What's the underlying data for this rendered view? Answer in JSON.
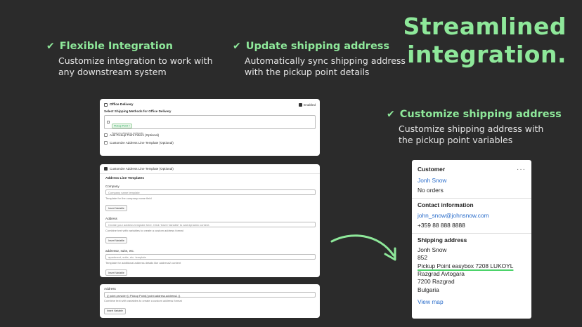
{
  "headline": {
    "line1": "Streamlined",
    "line2": "integration."
  },
  "features": [
    {
      "title": "Flexible Integration",
      "desc_l1": "Customize integration to work with",
      "desc_l2": "any downstream system"
    },
    {
      "title": "Update shipping address",
      "desc_l1": "Automatically sync shipping address",
      "desc_l2": "with the pickup point details"
    },
    {
      "title": "Customize shipping address",
      "desc_l1": "Customize  shipping address with",
      "desc_l2": "the pickup point variables"
    }
  ],
  "check_glyph": "✔",
  "office_card": {
    "title": "Office Delivery",
    "enabled_label": "Enabled",
    "select_label": "Select Shipping Methods for Office Delivery",
    "tag": "Pickup Point",
    "search_placeholder": "Search shipping methods",
    "opt1": "Add Pickup Point Filters (Optional)",
    "opt2": "Customize Address Line Template (Optional)"
  },
  "template_card": {
    "header": "Customize Address Line Template (Optional)",
    "section_title": "Address Line Templates",
    "fields": [
      {
        "label": "Company",
        "placeholder": "Company name template",
        "help": "Template for the company name field",
        "button": "Insert Variable"
      },
      {
        "label": "Address",
        "placeholder": "Create your address template here. Click 'Insert Variable' to add dynamic content.",
        "help": "Combine text with variables to create a custom address format",
        "button": "Insert Variable"
      },
      {
        "label": "address2, suite, etc.",
        "placeholder": "apartment, suite, etc. template",
        "help": "Template for additional address details like address2 content",
        "button": "Insert Variable"
      }
    ]
  },
  "address_card": {
    "label": "Address",
    "value": "{{ point.provider }} Pickup Point{{ point.address.address1 }}",
    "help": "Combine text with variables to create a custom address format",
    "button": "Insert Variable"
  },
  "customer": {
    "title": "Customer",
    "name": "Jonh Snow",
    "orders": "No orders",
    "contact_title": "Contact information",
    "email": "john_snow@johnsnow.com",
    "phone": "+359 88 888 8888",
    "shipping_title": "Shipping address",
    "addr": [
      "Jonh Snow",
      "852",
      "Pickup Point easybox 7208 LUKOYL",
      "Razgrad Avtogara",
      "7200 Razgrad",
      "Bulgaria"
    ],
    "view_map": "View map",
    "menu_icon": "more-horizontal-icon"
  },
  "colors": {
    "accent": "#8ee89a",
    "background": "#2b2b2b",
    "link": "#2c6ecb"
  }
}
